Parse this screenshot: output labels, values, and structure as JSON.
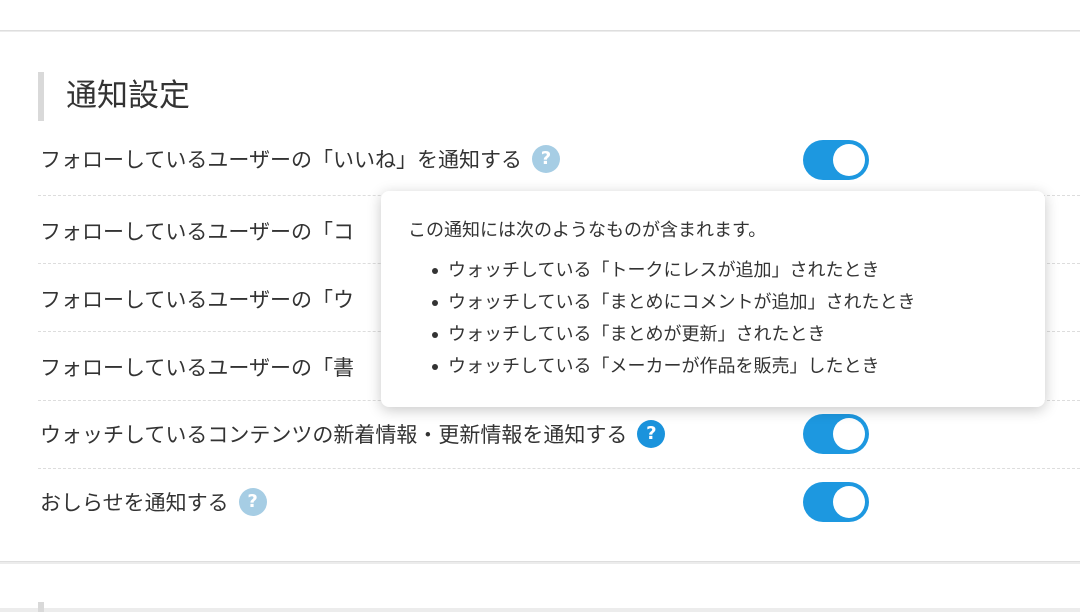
{
  "section": {
    "title": "通知設定"
  },
  "settings": [
    {
      "label": "フォローしているユーザーの「いいね」を通知する",
      "enabled": true,
      "help_style": "light"
    },
    {
      "label": "フォローしているユーザーの「コ",
      "enabled": true
    },
    {
      "label": "フォローしているユーザーの「ウ",
      "enabled": true
    },
    {
      "label": "フォローしているユーザーの「書",
      "enabled": true
    },
    {
      "label": "ウォッチしているコンテンツの新着情報・更新情報を通知する",
      "enabled": true,
      "help_style": "dark"
    },
    {
      "label": "おしらせを通知する",
      "enabled": true,
      "help_style": "light"
    }
  ],
  "help_icon": {
    "glyph": "?",
    "icon": "question-circle-icon"
  },
  "tooltip": {
    "intro": "この通知には次のようなものが含まれます。",
    "items": [
      "ウォッチしている「トークにレスが追加」されたとき",
      "ウォッチしている「まとめにコメントが追加」されたとき",
      "ウォッチしている「まとめが更新」されたとき",
      "ウォッチしている「メーカーが作品を販売」したとき"
    ]
  },
  "colors": {
    "toggle_on": "#1d98e0",
    "help_light": "#a6cde4",
    "help_dark": "#1a93dc"
  }
}
